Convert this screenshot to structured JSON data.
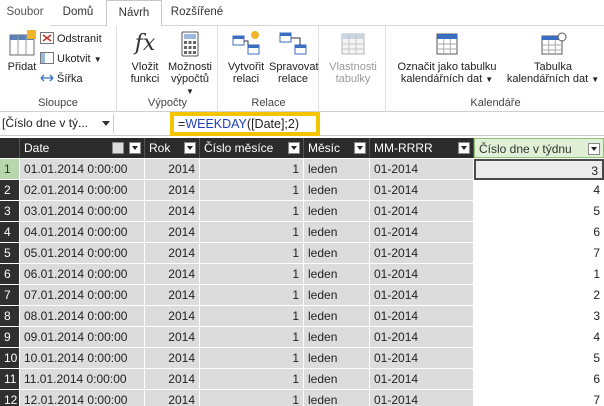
{
  "tabs": [
    {
      "label": "Soubor"
    },
    {
      "label": "Domů"
    },
    {
      "label": "Návrh"
    },
    {
      "label": "Rozšířené"
    }
  ],
  "ribbon": {
    "columns_group": {
      "label": "Sloupce",
      "add": "Přidat",
      "delete": "Odstranit",
      "freeze": "Ukotvit",
      "width": "Šířka"
    },
    "calc_group": {
      "label": "Výpočty",
      "insert_fn_1": "Vložit",
      "insert_fn_2": "funkci",
      "calc_options_1": "Možnosti",
      "calc_options_2": "výpočtů"
    },
    "relations_group": {
      "label": "Relace",
      "create_1": "Vytvořit",
      "create_2": "relaci",
      "manage_1": "Spravovat",
      "manage_2": "relace"
    },
    "props_group": {
      "props_1": "Vlastnosti",
      "props_2": "tabulky"
    },
    "calendar_group": {
      "label": "Kalendáře",
      "mark_1": "Označit jako tabulku",
      "mark_2": "kalendářních dat",
      "cal_1": "Tabulka",
      "cal_2": "kalendářních dat"
    }
  },
  "formula_bar": {
    "name_box": "[Číslo dne v tý...",
    "formula_prefix": "=",
    "formula_fn": "WEEKDAY",
    "formula_args": "([Date];2)"
  },
  "table": {
    "columns": [
      "Date",
      "Rok",
      "Číslo měsíce",
      "Měsíc",
      "MM-RRRR",
      "Číslo dne v týdnu"
    ],
    "rows": [
      {
        "n": "1",
        "date": "01.01.2014 0:00:00",
        "rok": "2014",
        "cm": "1",
        "mesic": "leden",
        "mm": "01-2014",
        "den": "3"
      },
      {
        "n": "2",
        "date": "02.01.2014 0:00:00",
        "rok": "2014",
        "cm": "1",
        "mesic": "leden",
        "mm": "01-2014",
        "den": "4"
      },
      {
        "n": "3",
        "date": "03.01.2014 0:00:00",
        "rok": "2014",
        "cm": "1",
        "mesic": "leden",
        "mm": "01-2014",
        "den": "5"
      },
      {
        "n": "4",
        "date": "04.01.2014 0:00:00",
        "rok": "2014",
        "cm": "1",
        "mesic": "leden",
        "mm": "01-2014",
        "den": "6"
      },
      {
        "n": "5",
        "date": "05.01.2014 0:00:00",
        "rok": "2014",
        "cm": "1",
        "mesic": "leden",
        "mm": "01-2014",
        "den": "7"
      },
      {
        "n": "6",
        "date": "06.01.2014 0:00:00",
        "rok": "2014",
        "cm": "1",
        "mesic": "leden",
        "mm": "01-2014",
        "den": "1"
      },
      {
        "n": "7",
        "date": "07.01.2014 0:00:00",
        "rok": "2014",
        "cm": "1",
        "mesic": "leden",
        "mm": "01-2014",
        "den": "2"
      },
      {
        "n": "8",
        "date": "08.01.2014 0:00:00",
        "rok": "2014",
        "cm": "1",
        "mesic": "leden",
        "mm": "01-2014",
        "den": "3"
      },
      {
        "n": "9",
        "date": "09.01.2014 0:00:00",
        "rok": "2014",
        "cm": "1",
        "mesic": "leden",
        "mm": "01-2014",
        "den": "4"
      },
      {
        "n": "10",
        "date": "10.01.2014 0:00:00",
        "rok": "2014",
        "cm": "1",
        "mesic": "leden",
        "mm": "01-2014",
        "den": "5"
      },
      {
        "n": "11",
        "date": "11.01.2014 0:00:00",
        "rok": "2014",
        "cm": "1",
        "mesic": "leden",
        "mm": "01-2014",
        "den": "6"
      },
      {
        "n": "12",
        "date": "12.01.2014 0:00:00",
        "rok": "2014",
        "cm": "1",
        "mesic": "leden",
        "mm": "01-2014",
        "den": "7"
      }
    ]
  },
  "colors": {
    "formula_highlight": "#f5c400",
    "header_bg": "#2b2b2b",
    "selected_column_header": "#dff0d6",
    "cell_bg": "#dcdcdc"
  }
}
